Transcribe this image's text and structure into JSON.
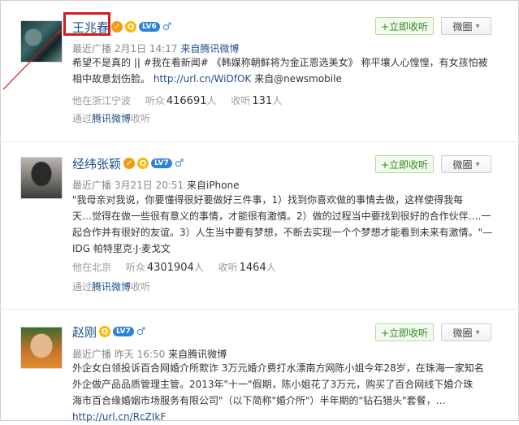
{
  "ui": {
    "follow_label": "+立即收听",
    "circle_label": "微圈",
    "circle_arrow": "▾"
  },
  "colors": {
    "link": "#1f4f8c",
    "highlight_box": "#d01c1c",
    "follow_green": "#2f8a1e"
  },
  "cards": [
    {
      "name": "王兆春",
      "level": "LV6",
      "gender": "♂",
      "meta_label": "最近广播",
      "time": "2月1日 14:17",
      "source": "来自腾讯微博",
      "text_lines": [
        "希望不是真的 || #我在看新闻# 《韩媒称朝鲜将为金正恩选美女》 称平壤人心惶惶，有女孩怕被",
        "相中故意划伤脸。"
      ],
      "link": "http://url.cn/WiDfOK",
      "link_suffix": " 来自@newsmobile",
      "location": "他在浙江宁波",
      "listeners_label": "听众",
      "listeners": "416691",
      "listens_label": "收听",
      "listens": "131",
      "unit": "人",
      "via_prefix": "通过",
      "via_source": "腾讯微博",
      "via_suffix": "收听"
    },
    {
      "name": "经纬张颖",
      "level": "LV7",
      "gender": "♂",
      "meta_label": "最近广播",
      "time": "3月21日 20:51",
      "source": "来自iPhone",
      "text_lines": [
        "\"我母亲对我说，你要懂得很好要做好三件事，1）找到你喜欢做的事情去做，这样使得我每",
        "天…觉得在做一些很有意义的事情，才能很有激情。2）做的过程当中要找到很好的合作伙伴….一",
        "起合作并有很好的友谊。3）人生当中要有梦想，不断去实现一个个梦想才能看到未来有激情。\"—",
        "IDG 帕特里克·J·麦戈文"
      ],
      "location": "他在北京",
      "listeners_label": "听众",
      "listeners": "4301904",
      "listens_label": "收听",
      "listens": "1464",
      "unit": "人",
      "via_prefix": "通过",
      "via_source": "腾讯微博",
      "via_suffix": "收听"
    },
    {
      "name": "赵刚",
      "level": "LV7",
      "gender": "♂",
      "meta_label": "最近广播",
      "time": "昨天 16:50",
      "source": "来自腾讯微博",
      "text_lines": [
        "外企女白领投诉百合网婚介所欺诈 3万元婚介费打水漂南方网陈小姐今年28岁，在珠海一家知名",
        "外企做产品品质管理主管。2013年\"十一\"假期，陈小姐花了3万元，购买了百合网线下婚介珠",
        "海市百合缘婚姻市场服务有限公司\"（以下简称\"婚介所\"）半年期的\"钻石猎头\"套餐，…"
      ],
      "link": "http://url.cn/RcZIkF"
    }
  ]
}
